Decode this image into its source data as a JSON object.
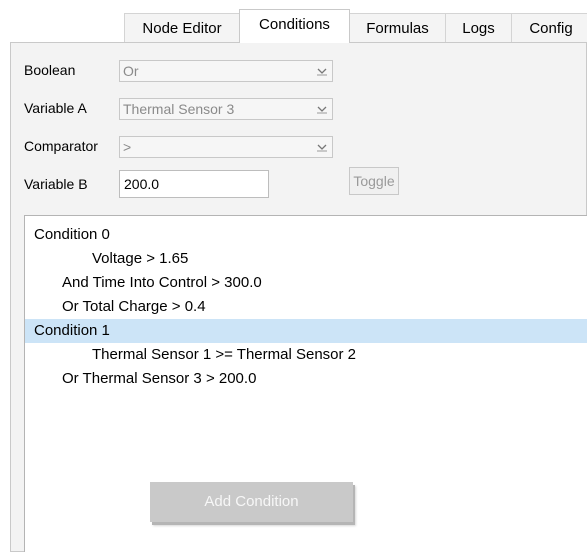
{
  "tabs": [
    {
      "label": "Node Editor"
    },
    {
      "label": "Conditions",
      "active": true
    },
    {
      "label": "Formulas"
    },
    {
      "label": "Logs"
    },
    {
      "label": "Config"
    }
  ],
  "form": {
    "boolean": {
      "label": "Boolean",
      "value": "Or"
    },
    "variable_a": {
      "label": "Variable A",
      "value": "Thermal Sensor 3"
    },
    "comparator": {
      "label": "Comparator",
      "value": ">"
    },
    "variable_b": {
      "label": "Variable B",
      "value": "200.0"
    },
    "toggle_label": "Toggle"
  },
  "conditions": [
    {
      "text": "Condition 0",
      "selected": false
    },
    {
      "text": "Voltage > 1.65",
      "selected": false
    },
    {
      "text": "And Time Into Control > 300.0",
      "selected": false
    },
    {
      "text": "Or  Total Charge > 0.4",
      "selected": false
    },
    {
      "text": "Condition 1",
      "selected": true
    },
    {
      "text": "Thermal Sensor 1 >= Thermal Sensor 2",
      "selected": false
    },
    {
      "text": "Or  Thermal Sensor 3 > 200.0",
      "selected": false
    }
  ],
  "add_condition_label": "Add Condition",
  "colors": {
    "selection": "#cce4f7",
    "disabled_button": "#c9c9c9",
    "panel": "#f3f3f3"
  },
  "icons": {
    "dropdown": "chevron-down-icon"
  }
}
